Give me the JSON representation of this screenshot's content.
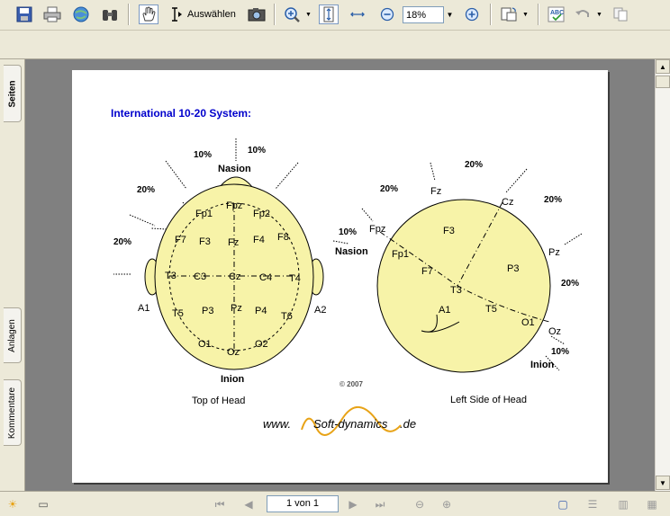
{
  "toolbar": {
    "select_label": "Auswählen",
    "zoom_value": "18%"
  },
  "side_tabs": [
    "Seiten",
    "Anlagen",
    "Kommentare"
  ],
  "statusbar": {
    "page_indicator": "1 von 1"
  },
  "document": {
    "title": "International 10-20 System:",
    "copyright": "© 2007",
    "footer_url": {
      "pre": "www.",
      "brand": "Soft-dynamics",
      "post": ".de"
    },
    "top_view": {
      "caption": "Top of Head",
      "landmarks": {
        "nasion": "Nasion",
        "inion": "Inion",
        "a1": "A1",
        "a2": "A2"
      },
      "percents": {
        "p10a": "10%",
        "p10b": "10%",
        "p20a": "20%",
        "p20b": "20%"
      },
      "electrodes": {
        "fpz": "Fpz",
        "fp1": "Fp1",
        "fp2": "Fp2",
        "f7": "F7",
        "f3": "F3",
        "fz": "Fz",
        "f4": "F4",
        "f8": "F8",
        "t3": "T3",
        "c3": "C3",
        "cz": "Cz",
        "c4": "C4",
        "t4": "T4",
        "t5": "T5",
        "p3": "P3",
        "pz": "Pz",
        "p4": "P4",
        "t6": "T6",
        "o1": "O1",
        "oz": "Oz",
        "o2": "O2"
      }
    },
    "side_view": {
      "caption": "Left Side of Head",
      "landmarks": {
        "nasion": "Nasion",
        "inion": "Inion",
        "a1": "A1"
      },
      "percents": {
        "p20a": "20%",
        "p20b": "20%",
        "p20c": "20%",
        "p20d": "20%",
        "p10a": "10%",
        "p10b": "10%"
      },
      "electrodes": {
        "fz": "Fz",
        "cz": "Cz",
        "pz": "Pz",
        "fpz": "Fpz",
        "oz": "Oz",
        "f3": "F3",
        "fp1": "Fp1",
        "f7": "F7",
        "p3": "P3",
        "t3": "T3",
        "t5": "T5",
        "o1": "O1"
      }
    }
  },
  "colors": {
    "title": "#0000cc",
    "head_fill": "#f7f3a8",
    "brand": "#e8a317"
  }
}
